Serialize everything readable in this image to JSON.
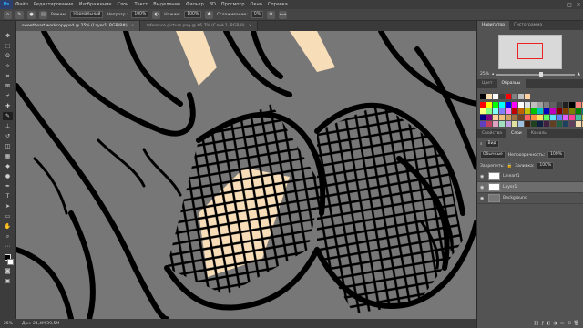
{
  "menubar": {
    "logo": "Ps",
    "items": [
      "Файл",
      "Редактирование",
      "Изображение",
      "Слои",
      "Текст",
      "Выделение",
      "Фильтр",
      "3D",
      "Просмотр",
      "Окно",
      "Справка"
    ],
    "window_controls": [
      "–",
      "□",
      "×"
    ]
  },
  "options": {
    "size_label": "Режим:",
    "mode_value": "Нормальный",
    "opacity_label": "Непрозр.:",
    "opacity_value": "100%",
    "flow_label": "Нажим:",
    "flow_value": "100%",
    "smooth_label": "Сглаживание:",
    "smooth_value": "0%"
  },
  "tabs": [
    {
      "label": "sweetheart workcopy.psd @ 25% (Layer1, RGB/8#)",
      "active": true
    },
    {
      "label": "reference picture.png @ 66.7% (Слой 1, RGB/8)",
      "active": false
    }
  ],
  "status": {
    "zoom": "25%",
    "doc": "Док: 24,4M/39,5M"
  },
  "navigator": {
    "tabs": [
      "Навигатор",
      "Гистограмма"
    ],
    "zoom": "25%"
  },
  "swatches": {
    "tabs": [
      "Цвет",
      "Образцы"
    ],
    "colors": [
      "#ff0000",
      "#ffff00",
      "#00ff00",
      "#00ffff",
      "#0000ff",
      "#ff00ff",
      "#ffffff",
      "#e0e0e0",
      "#c0c0c0",
      "#a0a0a0",
      "#808080",
      "#606060",
      "#404040",
      "#202020",
      "#000000",
      "#ff8080",
      "#ffb080",
      "#ffff80",
      "#80ff80",
      "#80ffff",
      "#8080ff",
      "#ff80ff",
      "#c00000",
      "#c06000",
      "#c0c000",
      "#00c000",
      "#00c0c0",
      "#0000c0",
      "#c000c0",
      "#800000",
      "#804000",
      "#808000",
      "#008000",
      "#008080",
      "#000080",
      "#800080",
      "#ffd0a0",
      "#f0c080",
      "#d0a060",
      "#a07040",
      "#704020",
      "#ff6060",
      "#ff9040",
      "#ffe060",
      "#60ff60",
      "#60e0ff",
      "#6080ff",
      "#e060ff",
      "#ff4090",
      "#40c0a0",
      "#a0c040",
      "#6040c0",
      "#c04060",
      "#e0a0c0",
      "#a0e0c0",
      "#c0a0e0",
      "#e0e0a0",
      "#a0c0e0",
      "#402010",
      "#204020",
      "#102040",
      "#402040",
      "#604020",
      "#206040",
      "#204060",
      "#604060",
      "#f5deb3",
      "#deb887"
    ],
    "recent": [
      "#000000",
      "#ffe0b0",
      "#ffffff",
      "#404040",
      "#ff0000",
      "#808080",
      "#c0c0c0",
      "#ffd0a0"
    ]
  },
  "layers": {
    "tabs": [
      "Свойства",
      "Слои",
      "Каналы"
    ],
    "kind_label": "Вид",
    "blend": "Обычные",
    "opacity_label": "Непрозрачность:",
    "opacity": "100%",
    "lock_label": "Закрепить:",
    "fill_label": "Заливка:",
    "fill": "100%",
    "items": [
      {
        "name": "Lineart1",
        "selected": false,
        "gray": false
      },
      {
        "name": "Layer1",
        "selected": true,
        "gray": false
      },
      {
        "name": "Background",
        "selected": false,
        "gray": true
      }
    ]
  },
  "colors": {
    "ui_dark": "#3c3c3c",
    "canvas_gray": "#777777",
    "skin": "#f7ddb8",
    "line": "#000000"
  }
}
